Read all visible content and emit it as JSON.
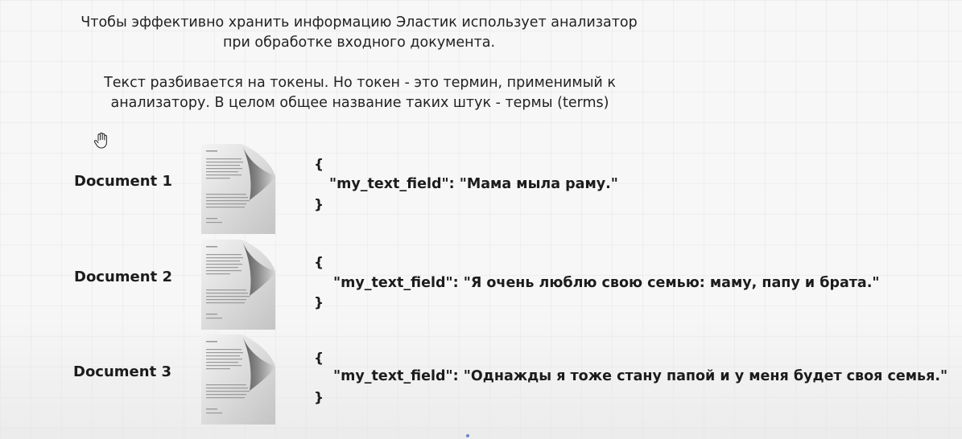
{
  "intro": {
    "paragraph_1": "Чтобы эффективно хранить информацию Эластик использует анализатор при обработке входного документа.",
    "paragraph_2": "Текст разбивается на токены. Но токен - это термин, применимый к анализатору. В целом общее название таких штук - термы (terms)"
  },
  "documents": [
    {
      "label": "Document 1",
      "open_brace": "{",
      "json_line": "\"my_text_field\": \"Мама мыла раму.\"",
      "close_brace": "}"
    },
    {
      "label": "Document 2",
      "open_brace": "{",
      "json_line": "\"my_text_field\": \"Я очень люблю свою семью: маму, папу и брата.\"",
      "close_brace": "}"
    },
    {
      "label": "Document 3",
      "open_brace": "{",
      "json_line": "\"my_text_field\": \"Однажды я тоже стану папой и у меня будет своя семья.\"",
      "close_brace": "}"
    }
  ],
  "icons": {
    "pointer": "hand-pointer-icon",
    "document": "document-page-icon"
  }
}
